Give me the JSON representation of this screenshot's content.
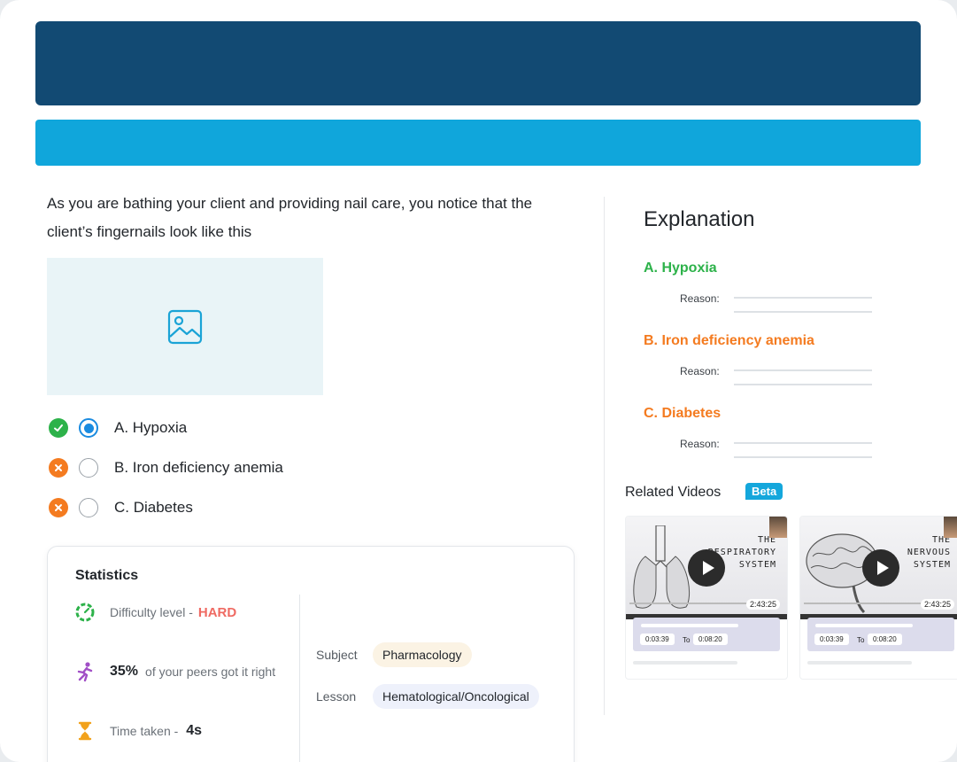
{
  "colors": {
    "header_dark": "#124a73",
    "header_light": "#10a6db",
    "correct": "#2db24a",
    "wrong": "#f47b20",
    "accent_blue": "#1a8be0",
    "hard": "#ef6a62",
    "beta": "#14a7dc",
    "pill_subject": "#fbf3e4",
    "pill_lesson": "#eef1fb"
  },
  "question": {
    "text": "As you are bathing your client and providing nail care, you notice that the client’s fingernails look like this",
    "image_icon": "image-icon"
  },
  "options": [
    {
      "label": "A. Hypoxia",
      "status": "correct",
      "selected": true
    },
    {
      "label": "B. Iron deficiency anemia",
      "status": "wrong",
      "selected": false
    },
    {
      "label": "C. Diabetes",
      "status": "wrong",
      "selected": false
    }
  ],
  "statistics": {
    "title": "Statistics",
    "difficulty_label": "Difficulty level -",
    "difficulty_value": "HARD",
    "peers_value": "35%",
    "peers_label": "of your peers got it right",
    "time_label": "Time taken -",
    "time_value": "4s",
    "subject_label": "Subject",
    "subject_value": "Pharmacology",
    "lesson_label": "Lesson",
    "lesson_value": "Hematological/Oncological"
  },
  "explanation": {
    "title": "Explanation",
    "items": [
      {
        "label": "A. Hypoxia",
        "reason_label": "Reason:",
        "status": "correct"
      },
      {
        "label": "B. Iron deficiency anemia",
        "reason_label": "Reason:",
        "status": "wrong"
      },
      {
        "label": "C. Diabetes",
        "reason_label": "Reason:",
        "status": "wrong"
      }
    ]
  },
  "related_videos": {
    "title": "Related Videos",
    "badge": "Beta",
    "videos": [
      {
        "thumb_title_1": "THE",
        "thumb_title_2": "RESPIRATORY",
        "thumb_title_3": "SYSTEM",
        "duration": "2:43:25",
        "start": "0:03:39",
        "to": "To",
        "end": "0:08:20"
      },
      {
        "thumb_title_1": "THE",
        "thumb_title_2": "NERVOUS",
        "thumb_title_3": "SYSTEM",
        "duration": "2:43:25",
        "start": "0:03:39",
        "to": "To",
        "end": "0:08:20"
      }
    ]
  }
}
